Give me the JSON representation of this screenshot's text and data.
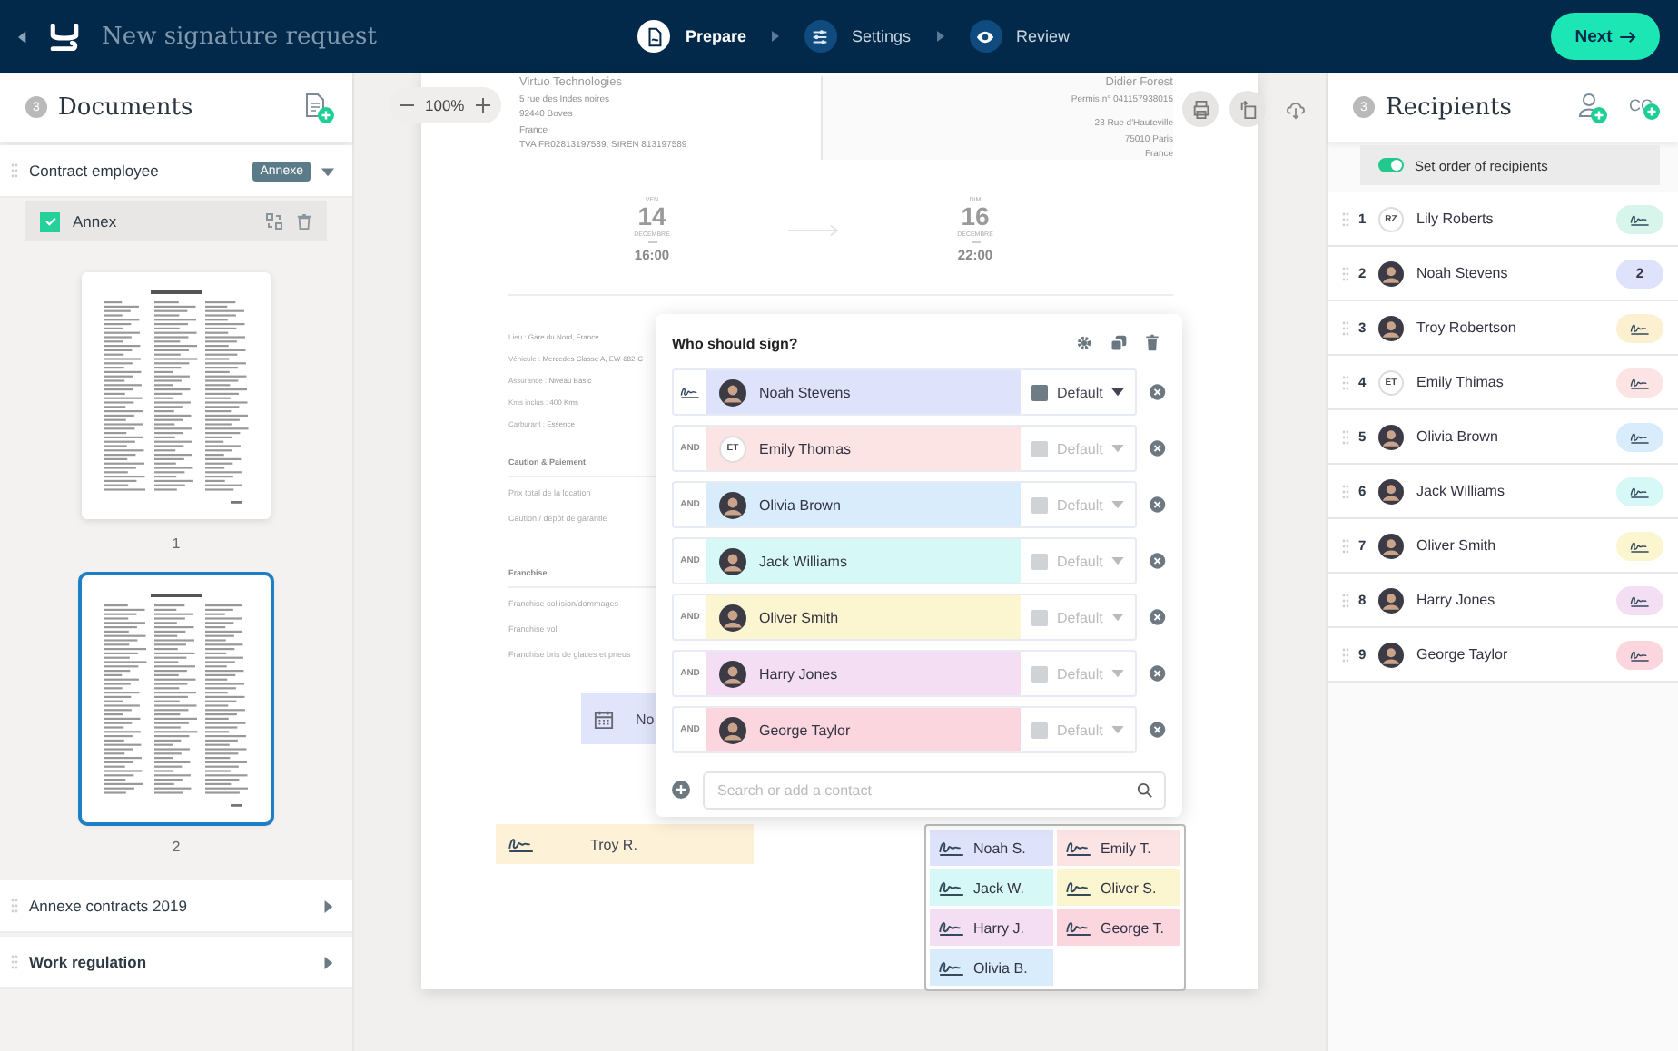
{
  "header": {
    "title": "New signature request",
    "steps": [
      {
        "label": "Prepare",
        "selected": true
      },
      {
        "label": "Settings",
        "selected": false
      },
      {
        "label": "Review",
        "selected": false
      }
    ],
    "next_button": "Next"
  },
  "documents": {
    "count": "3",
    "title": "Documents",
    "groups": [
      {
        "name": "Contract employee",
        "bold": false,
        "expanded": true,
        "tag": "Annexe",
        "files": [
          {
            "name": "Annex",
            "checked": true
          }
        ],
        "pages": [
          {
            "label": "1",
            "selected": false
          },
          {
            "label": "2",
            "selected": true
          }
        ]
      },
      {
        "name": "Annexe contracts 2019",
        "bold": false,
        "expanded": false
      },
      {
        "name": "Work regulation",
        "bold": true,
        "expanded": false
      }
    ]
  },
  "viewer": {
    "zoom": "100%"
  },
  "document": {
    "sender": [
      "Virtuo Technologies",
      "5 rue des Indes noires",
      "92440 Boves",
      "France",
      "TVA FR02813197589, SIREN 813197589"
    ],
    "recipient": [
      "Didier Forest",
      "Permis n° 041157938015",
      "23 Rue d'Hauteville",
      "75010 Paris",
      "France"
    ],
    "start": {
      "day": "VEN",
      "date": "14",
      "month": "DÉCEMBRE",
      "time": "16:00"
    },
    "end": {
      "day": "DIM",
      "date": "16",
      "month": "DÉCEMBRE",
      "time": "22:00"
    },
    "details": [
      {
        "label": "Lieu :",
        "value": "Gare du Nord, France"
      },
      {
        "label": "Véhicule :",
        "value": "Mercedes Classe A, EW-682-C"
      },
      {
        "label": "Assurance :",
        "value": "Niveau Basic"
      },
      {
        "label": "Kms inclus :",
        "value": "400 Kms"
      },
      {
        "label": "Carburant :",
        "value": "Essence"
      }
    ],
    "sections": [
      {
        "title": "Caution & Paiement",
        "lines": [
          "Prix total de la location",
          "Caution / dépôt de garantie"
        ]
      },
      {
        "title": "Franchise",
        "lines": [
          "Franchise collision/dommages",
          "Franchise vol",
          "Franchise bris de glaces et pneus"
        ]
      }
    ]
  },
  "fields": {
    "date_field": {
      "text": "No",
      "color": "#e1e5fb"
    },
    "signature_field": {
      "name": "Troy R.",
      "color": "#fdf2d8"
    },
    "chips": [
      {
        "name": "Noah S.",
        "color": "#dfe2fb"
      },
      {
        "name": "Emily T.",
        "color": "#fde4e4"
      },
      {
        "name": "Jack W.",
        "color": "#d6f8f6"
      },
      {
        "name": "Oliver S.",
        "color": "#fbf6d0"
      },
      {
        "name": "Harry J.",
        "color": "#f4def3"
      },
      {
        "name": "George T.",
        "color": "#fcd6df"
      },
      {
        "name": "Olivia B.",
        "color": "#d9ecfb"
      }
    ]
  },
  "dialog": {
    "title": "Who should sign?",
    "search_placeholder": "Search or add a contact",
    "signers": [
      {
        "kind": "first",
        "name": "Noah Stevens",
        "color": "#dfe2fb",
        "field": "Default",
        "active": true
      },
      {
        "kind": "and",
        "connector": "AND",
        "name": "Emily Thomas",
        "initials": "ET",
        "color": "#fde4e4",
        "field": "Default",
        "active": false
      },
      {
        "kind": "and",
        "connector": "AND",
        "name": "Olivia Brown",
        "color": "#d9ecfb",
        "field": "Default",
        "active": false
      },
      {
        "kind": "and",
        "connector": "AND",
        "name": "Jack Williams",
        "color": "#d6f8f6",
        "field": "Default",
        "active": false
      },
      {
        "kind": "and",
        "connector": "AND",
        "name": "Oliver Smith",
        "color": "#fbf6d0",
        "field": "Default",
        "active": false
      },
      {
        "kind": "and",
        "connector": "AND",
        "name": "Harry Jones",
        "color": "#f4def3",
        "field": "Default",
        "active": false
      },
      {
        "kind": "and",
        "connector": "AND",
        "name": "George Taylor",
        "color": "#fcd6df",
        "field": "Default",
        "active": false
      }
    ]
  },
  "recipients": {
    "count": "3",
    "title": "Recipients",
    "cc_label": "CC",
    "order_toggle": {
      "label": "Set order of recipients",
      "on": true
    },
    "items": [
      {
        "number": "1",
        "name": "Lily Roberts",
        "initials": "RZ",
        "kind": "signature",
        "color": "#d7f5ea"
      },
      {
        "number": "2",
        "name": "Noah Stevens",
        "kind": "count",
        "badge": "2",
        "color": "#dfe2fb"
      },
      {
        "number": "3",
        "name": "Troy Robertson",
        "kind": "signature",
        "color": "#fdf0d0"
      },
      {
        "number": "4",
        "name": "Emily Thimas",
        "initials": "ET",
        "kind": "signature",
        "color": "#fde4e4"
      },
      {
        "number": "5",
        "name": "Olivia Brown",
        "kind": "signature",
        "color": "#d9ecfb"
      },
      {
        "number": "6",
        "name": "Jack Williams",
        "kind": "signature",
        "color": "#d6f8f6"
      },
      {
        "number": "7",
        "name": "Oliver Smith",
        "kind": "signature",
        "color": "#fbf6d0"
      },
      {
        "number": "8",
        "name": "Harry Jones",
        "kind": "signature",
        "color": "#f4def3"
      },
      {
        "number": "9",
        "name": "George Taylor",
        "kind": "signature",
        "color": "#fcd6df"
      }
    ]
  }
}
